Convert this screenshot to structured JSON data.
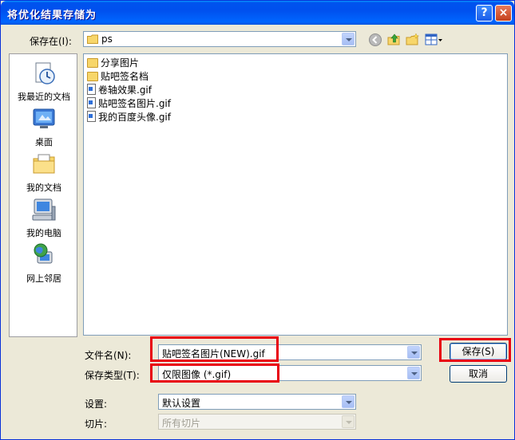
{
  "window": {
    "title": "将优化结果存储为",
    "help_glyph": "?",
    "close_glyph": "×"
  },
  "toolbar": {
    "save_in_label": "保存在(I):",
    "location": "ps"
  },
  "places": [
    {
      "label": "我最近的文档",
      "icon": "recent-documents-icon"
    },
    {
      "label": "桌面",
      "icon": "desktop-icon"
    },
    {
      "label": "我的文档",
      "icon": "my-documents-icon"
    },
    {
      "label": "我的电脑",
      "icon": "my-computer-icon"
    },
    {
      "label": "网上邻居",
      "icon": "network-places-icon"
    }
  ],
  "files": [
    {
      "name": "分享图片",
      "type": "folder"
    },
    {
      "name": "贴吧签名档",
      "type": "folder"
    },
    {
      "name": "卷轴效果.gif",
      "type": "gif"
    },
    {
      "name": "贴吧签名图片.gif",
      "type": "gif"
    },
    {
      "name": "我的百度头像.gif",
      "type": "gif"
    }
  ],
  "form": {
    "filename_label": "文件名(N):",
    "filename_value": "贴吧签名图片(NEW).gif",
    "filetype_label": "保存类型(T):",
    "filetype_value": "仅限图像 (*.gif)",
    "settings_label": "设置:",
    "settings_value": "默认设置",
    "slices_label": "切片:",
    "slices_value": "所有切片"
  },
  "buttons": {
    "save": "保存(S)",
    "cancel": "取消"
  },
  "colors": {
    "highlight": "#E8000F",
    "titlebar": "#0053EE"
  }
}
